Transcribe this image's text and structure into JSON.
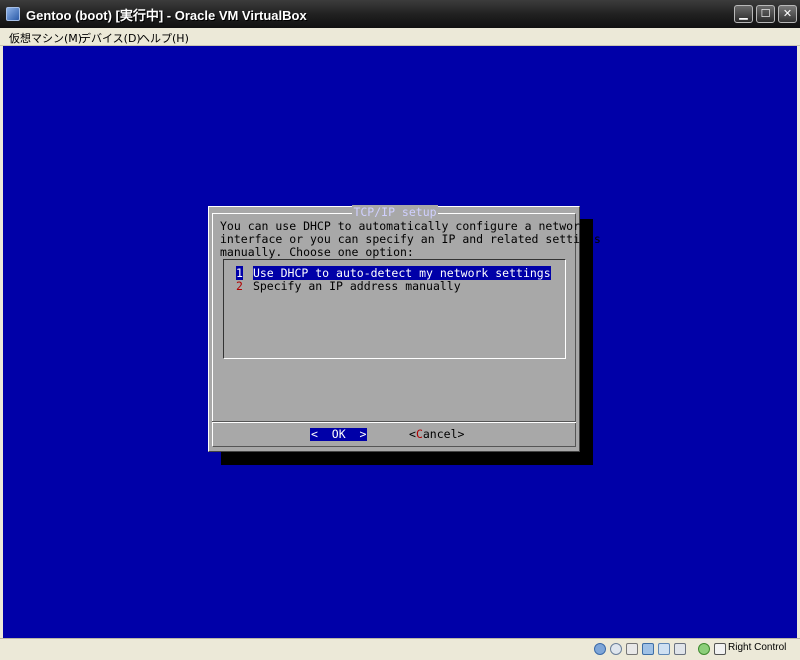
{
  "window": {
    "title": "Gentoo (boot) [実行中] - Oracle VM VirtualBox",
    "min_glyph": "▁",
    "max_glyph": "☐",
    "close_glyph": "✕"
  },
  "menu": [
    {
      "label": "仮想マシン(M)"
    },
    {
      "label": "デバイス(D)"
    },
    {
      "label": "ヘルプ(H)"
    }
  ],
  "dialog": {
    "title": "TCP/IP setup",
    "text": "You can use DHCP to automatically configure a network\ninterface or you can specify an IP and related settings\nmanually. Choose one option:",
    "options": [
      {
        "key": "1",
        "label": "Use DHCP to auto-detect my network settings",
        "selected": true
      },
      {
        "key": "2",
        "label": "Specify an IP address manually",
        "selected": false
      }
    ],
    "ok_label": "<  OK  >",
    "cancel_prefix": "<",
    "cancel_hot": "C",
    "cancel_rest": "ancel>"
  },
  "statusbar": {
    "icons": [
      "hdd-icon",
      "cd-icon",
      "usb-icon",
      "network-icon",
      "shared-folder-icon",
      "display-icon",
      "capture-icon",
      "mouse-integration-icon"
    ],
    "host_key": "Right Control"
  },
  "colors": {
    "vm_background": "#0000a8",
    "dialog_background": "#a8a8a8",
    "hotkey": "#b00000",
    "selection": "#0000a8"
  }
}
